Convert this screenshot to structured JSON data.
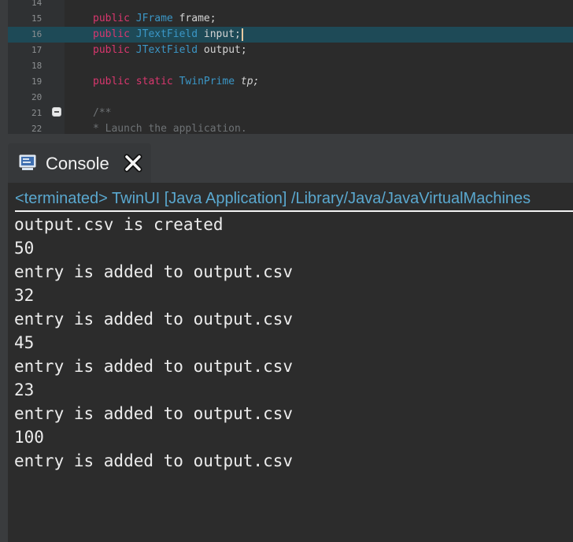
{
  "editor": {
    "lines": [
      {
        "num": "14",
        "tokens": []
      },
      {
        "num": "15",
        "tokens": [
          {
            "t": "public ",
            "c": "kw"
          },
          {
            "t": "JFrame ",
            "c": "ty"
          },
          {
            "t": "frame;",
            "c": "id"
          }
        ]
      },
      {
        "num": "16",
        "current": true,
        "caret": true,
        "tokens": [
          {
            "t": "public ",
            "c": "kw"
          },
          {
            "t": "JTextField ",
            "c": "ty"
          },
          {
            "t": "input;",
            "c": "id"
          }
        ]
      },
      {
        "num": "17",
        "tokens": [
          {
            "t": "public ",
            "c": "kw"
          },
          {
            "t": "JTextField ",
            "c": "ty"
          },
          {
            "t": "output;",
            "c": "id"
          }
        ]
      },
      {
        "num": "18",
        "tokens": []
      },
      {
        "num": "19",
        "tokens": [
          {
            "t": "public ",
            "c": "kw"
          },
          {
            "t": "static ",
            "c": "kw"
          },
          {
            "t": "TwinPrime ",
            "c": "ty"
          },
          {
            "t": "tp;",
            "c": "id it"
          }
        ]
      },
      {
        "num": "20",
        "tokens": []
      },
      {
        "num": "21",
        "tokens": [
          {
            "t": "/**",
            "c": "cm"
          }
        ]
      },
      {
        "num": "22",
        "tokens": [
          {
            "t": " * Launch the application.",
            "c": "cm"
          }
        ]
      }
    ]
  },
  "console": {
    "tab_label": "Console",
    "status": "<terminated> TwinUI [Java Application] /Library/Java/JavaVirtualMachines",
    "output": [
      "output.csv is created",
      "50",
      "entry is added to output.csv",
      "32",
      "entry is added to output.csv",
      "45",
      "entry is added to output.csv",
      "23",
      "entry is added to output.csv",
      "100",
      "entry is added to output.csv"
    ]
  },
  "icons": {
    "console": "console-icon",
    "close": "close-icon",
    "fold": "fold-collapse-icon",
    "bookmark": "bookmark-marker-icon"
  },
  "colors": {
    "keyword": "#d9376e",
    "type": "#3b97c7",
    "status": "#5aa8cf",
    "current_line": "#1e4a57"
  }
}
